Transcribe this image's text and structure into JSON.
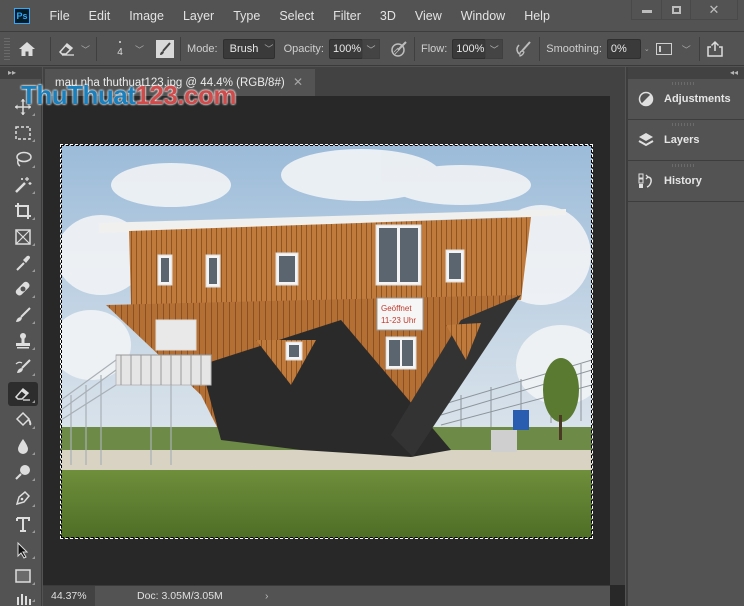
{
  "app": {
    "logo": "Ps"
  },
  "menu": [
    "File",
    "Edit",
    "Image",
    "Layer",
    "Type",
    "Select",
    "Filter",
    "3D",
    "View",
    "Window",
    "Help"
  ],
  "window_controls": {
    "minimize": "minimize",
    "maximize": "maximize",
    "close": "✕"
  },
  "options_bar": {
    "brush_size": "4",
    "mode_label": "Mode:",
    "mode_value": "Brush",
    "opacity_label": "Opacity:",
    "opacity_value": "100%",
    "flow_label": "Flow:",
    "flow_value": "100%",
    "smoothing_label": "Smoothing:",
    "smoothing_value": "0%"
  },
  "collapse_left": "▸▸",
  "collapse_right": "◂◂",
  "document": {
    "tab_title": "mau nha thuthuat123.jpg @ 44.4% (RGB/8#)",
    "tab_close": "✕",
    "sign_text_line1": "Geöffnet",
    "sign_text_line2": "11-23 Uhr"
  },
  "status_bar": {
    "zoom": "44.37%",
    "doc_info": "Doc: 3.05M/3.05M",
    "arrow": "›"
  },
  "panels": [
    {
      "label": "Adjustments",
      "icon": "adjustments-icon"
    },
    {
      "label": "Layers",
      "icon": "layers-icon"
    },
    {
      "label": "History",
      "icon": "history-icon"
    }
  ],
  "tools": [
    "move-tool",
    "marquee-tool",
    "lasso-tool",
    "magic-wand-tool",
    "crop-tool",
    "frame-tool",
    "eyedropper-tool",
    "healing-brush-tool",
    "brush-tool",
    "clone-stamp-tool",
    "history-brush-tool",
    "eraser-tool",
    "paint-bucket-tool",
    "blur-tool",
    "dodge-tool",
    "pen-tool",
    "type-tool",
    "path-selection-tool",
    "rectangle-tool",
    "more-tools"
  ],
  "active_tool": "eraser-tool",
  "watermark": {
    "part1": "ThuThuat",
    "part2": "123.com"
  }
}
